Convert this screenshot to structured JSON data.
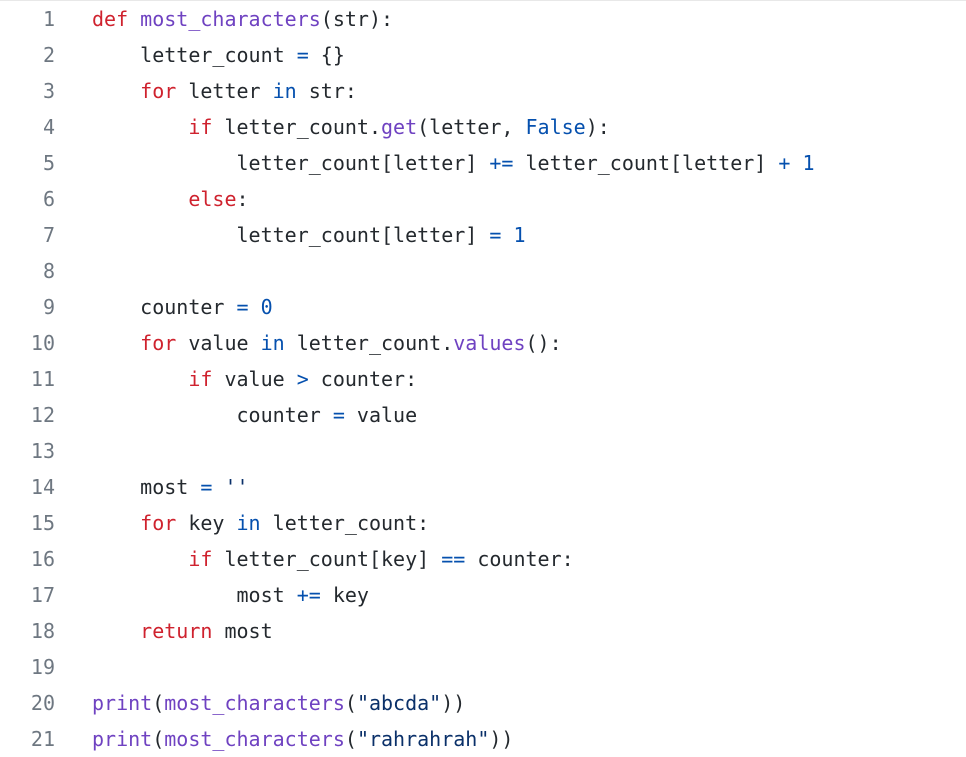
{
  "editor": {
    "colors": {
      "keyword": "#cf222e",
      "function": "#6f42c1",
      "operator": "#0550ae",
      "number": "#0550ae",
      "string": "#0a3069",
      "text": "#24292e",
      "line_number": "#6e7781",
      "background": "#ffffff"
    },
    "lines": [
      {
        "number": "1",
        "tokens": [
          {
            "text": "def",
            "type": "keyword"
          },
          {
            "text": " ",
            "type": "text"
          },
          {
            "text": "most_characters",
            "type": "function"
          },
          {
            "text": "(str):",
            "type": "text"
          }
        ]
      },
      {
        "number": "2",
        "tokens": [
          {
            "text": "    letter_count ",
            "type": "text"
          },
          {
            "text": "=",
            "type": "operator"
          },
          {
            "text": " {}",
            "type": "text"
          }
        ]
      },
      {
        "number": "3",
        "tokens": [
          {
            "text": "    ",
            "type": "text"
          },
          {
            "text": "for",
            "type": "keyword"
          },
          {
            "text": " letter ",
            "type": "text"
          },
          {
            "text": "in",
            "type": "operator"
          },
          {
            "text": " str:",
            "type": "text"
          }
        ]
      },
      {
        "number": "4",
        "tokens": [
          {
            "text": "        ",
            "type": "text"
          },
          {
            "text": "if",
            "type": "keyword"
          },
          {
            "text": " letter_count.",
            "type": "text"
          },
          {
            "text": "get",
            "type": "function"
          },
          {
            "text": "(letter, ",
            "type": "text"
          },
          {
            "text": "False",
            "type": "number"
          },
          {
            "text": "):",
            "type": "text"
          }
        ]
      },
      {
        "number": "5",
        "tokens": [
          {
            "text": "            letter_count[letter] ",
            "type": "text"
          },
          {
            "text": "+=",
            "type": "operator"
          },
          {
            "text": " letter_count[letter] ",
            "type": "text"
          },
          {
            "text": "+",
            "type": "operator"
          },
          {
            "text": " ",
            "type": "text"
          },
          {
            "text": "1",
            "type": "number"
          }
        ]
      },
      {
        "number": "6",
        "tokens": [
          {
            "text": "        ",
            "type": "text"
          },
          {
            "text": "else",
            "type": "keyword"
          },
          {
            "text": ":",
            "type": "text"
          }
        ]
      },
      {
        "number": "7",
        "tokens": [
          {
            "text": "            letter_count[letter] ",
            "type": "text"
          },
          {
            "text": "=",
            "type": "operator"
          },
          {
            "text": " ",
            "type": "text"
          },
          {
            "text": "1",
            "type": "number"
          }
        ]
      },
      {
        "number": "8",
        "tokens": []
      },
      {
        "number": "9",
        "tokens": [
          {
            "text": "    counter ",
            "type": "text"
          },
          {
            "text": "=",
            "type": "operator"
          },
          {
            "text": " ",
            "type": "text"
          },
          {
            "text": "0",
            "type": "number"
          }
        ]
      },
      {
        "number": "10",
        "tokens": [
          {
            "text": "    ",
            "type": "text"
          },
          {
            "text": "for",
            "type": "keyword"
          },
          {
            "text": " value ",
            "type": "text"
          },
          {
            "text": "in",
            "type": "operator"
          },
          {
            "text": " letter_count.",
            "type": "text"
          },
          {
            "text": "values",
            "type": "function"
          },
          {
            "text": "():",
            "type": "text"
          }
        ]
      },
      {
        "number": "11",
        "tokens": [
          {
            "text": "        ",
            "type": "text"
          },
          {
            "text": "if",
            "type": "keyword"
          },
          {
            "text": " value ",
            "type": "text"
          },
          {
            "text": ">",
            "type": "operator"
          },
          {
            "text": " counter:",
            "type": "text"
          }
        ]
      },
      {
        "number": "12",
        "tokens": [
          {
            "text": "            counter ",
            "type": "text"
          },
          {
            "text": "=",
            "type": "operator"
          },
          {
            "text": " value",
            "type": "text"
          }
        ]
      },
      {
        "number": "13",
        "tokens": []
      },
      {
        "number": "14",
        "tokens": [
          {
            "text": "    most ",
            "type": "text"
          },
          {
            "text": "=",
            "type": "operator"
          },
          {
            "text": " ",
            "type": "text"
          },
          {
            "text": "''",
            "type": "string"
          }
        ]
      },
      {
        "number": "15",
        "tokens": [
          {
            "text": "    ",
            "type": "text"
          },
          {
            "text": "for",
            "type": "keyword"
          },
          {
            "text": " key ",
            "type": "text"
          },
          {
            "text": "in",
            "type": "operator"
          },
          {
            "text": " letter_count:",
            "type": "text"
          }
        ]
      },
      {
        "number": "16",
        "tokens": [
          {
            "text": "        ",
            "type": "text"
          },
          {
            "text": "if",
            "type": "keyword"
          },
          {
            "text": " letter_count[key] ",
            "type": "text"
          },
          {
            "text": "==",
            "type": "operator"
          },
          {
            "text": " counter:",
            "type": "text"
          }
        ]
      },
      {
        "number": "17",
        "tokens": [
          {
            "text": "            most ",
            "type": "text"
          },
          {
            "text": "+=",
            "type": "operator"
          },
          {
            "text": " key",
            "type": "text"
          }
        ]
      },
      {
        "number": "18",
        "tokens": [
          {
            "text": "    ",
            "type": "text"
          },
          {
            "text": "return",
            "type": "keyword"
          },
          {
            "text": " most",
            "type": "text"
          }
        ]
      },
      {
        "number": "19",
        "tokens": []
      },
      {
        "number": "20",
        "tokens": [
          {
            "text": "print",
            "type": "function"
          },
          {
            "text": "(",
            "type": "text"
          },
          {
            "text": "most_characters",
            "type": "function"
          },
          {
            "text": "(",
            "type": "text"
          },
          {
            "text": "\"abcda\"",
            "type": "string"
          },
          {
            "text": "))",
            "type": "text"
          }
        ]
      },
      {
        "number": "21",
        "tokens": [
          {
            "text": "print",
            "type": "function"
          },
          {
            "text": "(",
            "type": "text"
          },
          {
            "text": "most_characters",
            "type": "function"
          },
          {
            "text": "(",
            "type": "text"
          },
          {
            "text": "\"rahrahrah\"",
            "type": "string"
          },
          {
            "text": "))",
            "type": "text"
          }
        ]
      }
    ]
  }
}
